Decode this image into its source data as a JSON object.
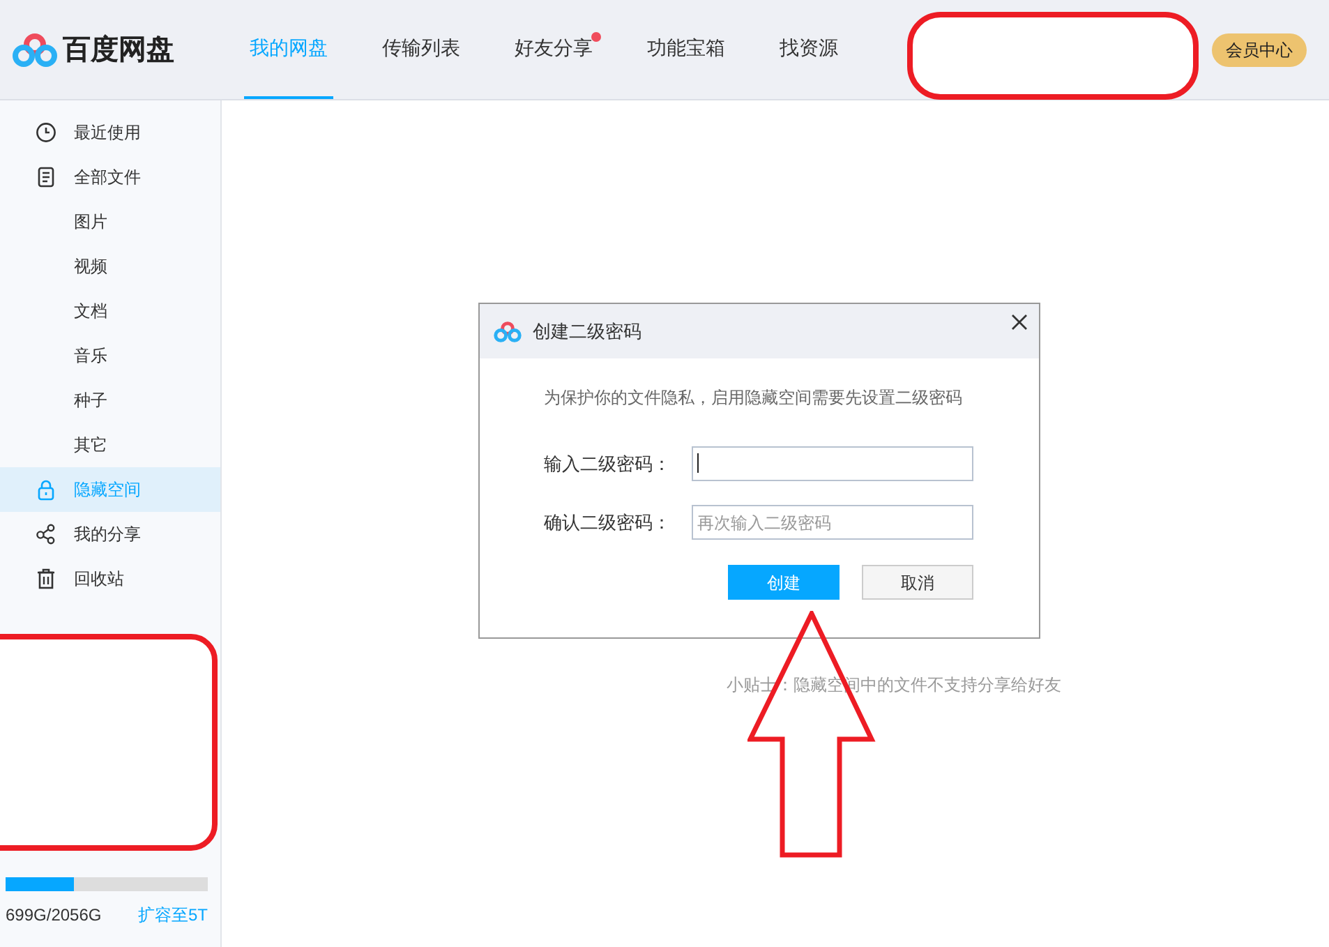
{
  "app": {
    "name": "百度网盘"
  },
  "tabs": [
    {
      "label": "我的网盘",
      "selected": true,
      "badge": false
    },
    {
      "label": "传输列表",
      "selected": false,
      "badge": false
    },
    {
      "label": "好友分享",
      "selected": false,
      "badge": true
    },
    {
      "label": "功能宝箱",
      "selected": false,
      "badge": false
    },
    {
      "label": "找资源",
      "selected": false,
      "badge": false
    }
  ],
  "vip_button": "会员中心",
  "sidebar": {
    "items": [
      {
        "label": "最近使用",
        "kind": "clock",
        "selected": false
      },
      {
        "label": "全部文件",
        "kind": "file",
        "selected": false,
        "children": [
          {
            "label": "图片",
            "selected": false
          },
          {
            "label": "视频",
            "selected": false
          },
          {
            "label": "文档",
            "selected": false
          },
          {
            "label": "音乐",
            "selected": false
          },
          {
            "label": "种子",
            "selected": false
          },
          {
            "label": "其它",
            "selected": false
          }
        ]
      },
      {
        "label": "隐藏空间",
        "kind": "lock",
        "selected": true
      },
      {
        "label": "我的分享",
        "kind": "share",
        "selected": false
      },
      {
        "label": "回收站",
        "kind": "trash",
        "selected": false
      }
    ]
  },
  "storage": {
    "level": 0.34,
    "usage": "699G/2056G",
    "expand_link": "扩容至5T"
  },
  "tip": "小贴士：隐藏空间中的文件不支持分享给好友",
  "dialog": {
    "title": "创建二级密码",
    "message": "为保护你的文件隐私，启用隐藏空间需要先设置二级密码",
    "fields": [
      {
        "label": "输入二级密码：",
        "focused": true
      },
      {
        "label": "确认二级密码：",
        "placeholder": "再次输入二级密码",
        "focused": false
      }
    ],
    "buttons": [
      {
        "label": "创建",
        "kind": "primary"
      },
      {
        "label": "取消",
        "kind": "secondary"
      }
    ]
  }
}
